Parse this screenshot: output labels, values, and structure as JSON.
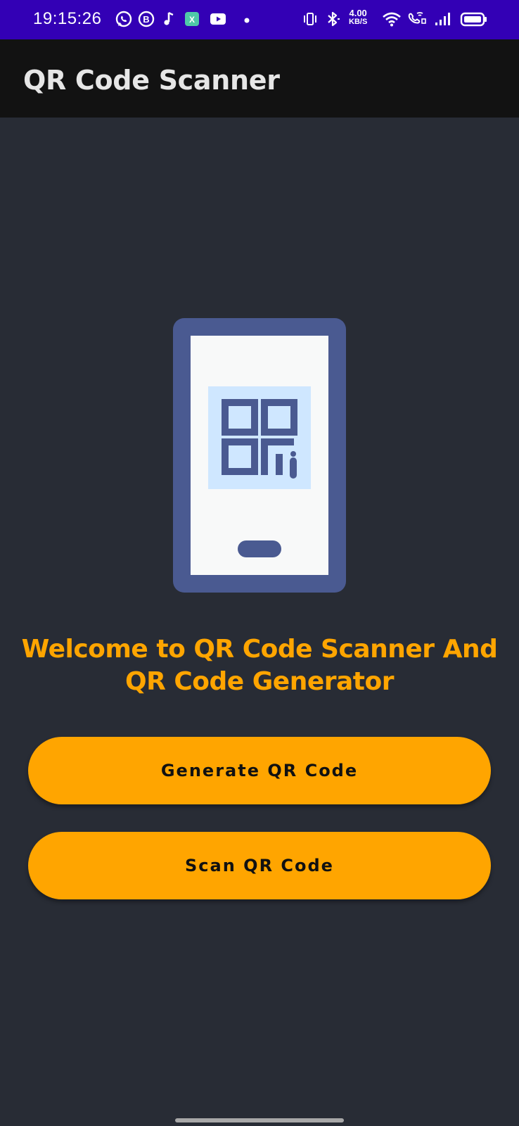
{
  "status_bar": {
    "time": "19:15:26",
    "net_speed_value": "4.00",
    "net_speed_unit": "KB/S",
    "background_color": "#3300b5",
    "icons": [
      "whatsapp-icon",
      "b-app-icon",
      "music-note-icon",
      "app-badge-icon",
      "youtube-icon",
      "dot-icon",
      "vibrate-icon",
      "bluetooth-icon",
      "wifi-icon",
      "wifi-calling-icon",
      "signal-icon",
      "battery-icon"
    ]
  },
  "app_bar": {
    "title": "QR Code Scanner",
    "background_color": "#121212"
  },
  "main": {
    "illustration_icon": "phone-qr-icon",
    "welcome_text": "Welcome to QR Code Scanner And QR Code Generator",
    "welcome_color": "#ffa500",
    "buttons": {
      "generate_label": "Generate QR Code",
      "scan_label": "Scan QR Code"
    },
    "button_color": "#ffa500",
    "background_color": "#282c35"
  }
}
